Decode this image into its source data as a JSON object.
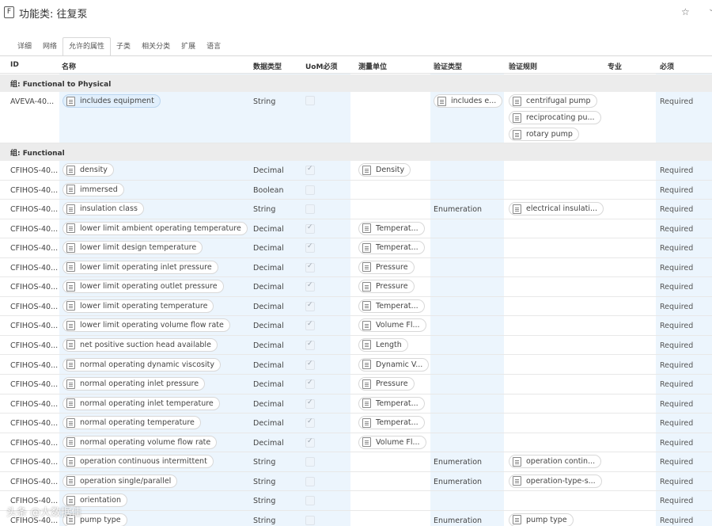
{
  "header": {
    "icon_letter": "F",
    "title": "功能类: 往复泵"
  },
  "tabs": [
    "详细",
    "网络",
    "允许的属性",
    "子类",
    "相关分类",
    "扩展",
    "语言"
  ],
  "columns": {
    "id": "ID",
    "name": "名称",
    "data_type": "数据类型",
    "uom_required": "UoM必须",
    "unit": "测量单位",
    "validation_type": "验证类型",
    "validation_rule": "验证规则",
    "discipline": "专业",
    "required": "必须"
  },
  "group1": {
    "label": "组: Functional to Physical",
    "row": {
      "id": "AVEVA-40...",
      "name": "includes equipment",
      "type": "String",
      "vtype_chip": "includes e...",
      "rules": [
        "centrifugal pump",
        "reciprocating pu...",
        "rotary pump"
      ],
      "required": "Required"
    }
  },
  "group2": {
    "label": "组: Functional",
    "rows": [
      {
        "id": "CFIHOS-40...",
        "name": "density",
        "type": "Decimal",
        "uom": true,
        "unit": "Density",
        "vtype": "",
        "rule": "",
        "required": "Required"
      },
      {
        "id": "CFIHOS-40...",
        "name": "immersed",
        "type": "Boolean",
        "uom": false,
        "unit": "",
        "vtype": "",
        "rule": "",
        "required": "Required"
      },
      {
        "id": "CFIHOS-40...",
        "name": "insulation class",
        "type": "String",
        "uom": false,
        "unit": "",
        "vtype": "Enumeration",
        "rule": "electrical insulati...",
        "required": "Required"
      },
      {
        "id": "CFIHOS-40...",
        "name": "lower limit ambient operating temperature",
        "type": "Decimal",
        "uom": true,
        "unit": "Temperat...",
        "vtype": "",
        "rule": "",
        "required": "Required"
      },
      {
        "id": "CFIHOS-40...",
        "name": "lower limit design temperature",
        "type": "Decimal",
        "uom": true,
        "unit": "Temperat...",
        "vtype": "",
        "rule": "",
        "required": "Required"
      },
      {
        "id": "CFIHOS-40...",
        "name": "lower limit operating inlet pressure",
        "type": "Decimal",
        "uom": true,
        "unit": "Pressure",
        "vtype": "",
        "rule": "",
        "required": "Required"
      },
      {
        "id": "CFIHOS-40...",
        "name": "lower limit operating outlet pressure",
        "type": "Decimal",
        "uom": true,
        "unit": "Pressure",
        "vtype": "",
        "rule": "",
        "required": "Required"
      },
      {
        "id": "CFIHOS-40...",
        "name": "lower limit operating temperature",
        "type": "Decimal",
        "uom": true,
        "unit": "Temperat...",
        "vtype": "",
        "rule": "",
        "required": "Required"
      },
      {
        "id": "CFIHOS-40...",
        "name": "lower limit operating volume flow rate",
        "type": "Decimal",
        "uom": true,
        "unit": "Volume Fl...",
        "vtype": "",
        "rule": "",
        "required": "Required"
      },
      {
        "id": "CFIHOS-40...",
        "name": "net positive suction head available",
        "type": "Decimal",
        "uom": true,
        "unit": "Length",
        "vtype": "",
        "rule": "",
        "required": "Required"
      },
      {
        "id": "CFIHOS-40...",
        "name": "normal operating dynamic viscosity",
        "type": "Decimal",
        "uom": true,
        "unit": "Dynamic V...",
        "vtype": "",
        "rule": "",
        "required": "Required"
      },
      {
        "id": "CFIHOS-40...",
        "name": "normal operating inlet pressure",
        "type": "Decimal",
        "uom": true,
        "unit": "Pressure",
        "vtype": "",
        "rule": "",
        "required": "Required"
      },
      {
        "id": "CFIHOS-40...",
        "name": "normal operating inlet temperature",
        "type": "Decimal",
        "uom": true,
        "unit": "Temperat...",
        "vtype": "",
        "rule": "",
        "required": "Required"
      },
      {
        "id": "CFIHOS-40...",
        "name": "normal operating temperature",
        "type": "Decimal",
        "uom": true,
        "unit": "Temperat...",
        "vtype": "",
        "rule": "",
        "required": "Required"
      },
      {
        "id": "CFIHOS-40...",
        "name": "normal operating volume flow rate",
        "type": "Decimal",
        "uom": true,
        "unit": "Volume Fl...",
        "vtype": "",
        "rule": "",
        "required": "Required"
      },
      {
        "id": "CFIHOS-40...",
        "name": "operation continuous intermittent",
        "type": "String",
        "uom": false,
        "unit": "",
        "vtype": "Enumeration",
        "rule": "operation contin...",
        "required": "Required"
      },
      {
        "id": "CFIHOS-40...",
        "name": "operation single/parallel",
        "type": "String",
        "uom": false,
        "unit": "",
        "vtype": "Enumeration",
        "rule": "operation-type-s...",
        "required": "Required"
      },
      {
        "id": "CFIHOS-40...",
        "name": "orientation",
        "type": "String",
        "uom": false,
        "unit": "",
        "vtype": "",
        "rule": "",
        "required": "Required"
      },
      {
        "id": "CFIHOS-40...",
        "name": "pump type",
        "type": "String",
        "uom": false,
        "unit": "",
        "vtype": "Enumeration",
        "rule": "pump type",
        "required": "Required"
      }
    ]
  },
  "watermark": "头条 @大数据佳",
  "colors": {
    "highlight_column": "#ecf5fd",
    "group_bg": "#ececec",
    "chip_blue": "#e1effc"
  }
}
